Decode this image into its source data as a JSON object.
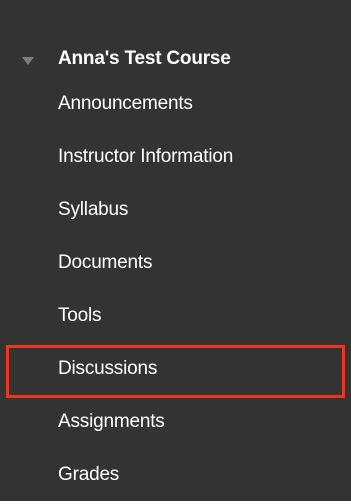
{
  "course": {
    "title": "Anna's Test Course",
    "expanded": true,
    "disclosure_icon": "triangle-down-icon"
  },
  "menu": {
    "items": [
      {
        "label": "Announcements",
        "highlighted": false
      },
      {
        "label": "Instructor Information",
        "highlighted": false
      },
      {
        "label": "Syllabus",
        "highlighted": false
      },
      {
        "label": "Documents",
        "highlighted": false
      },
      {
        "label": "Tools",
        "highlighted": false
      },
      {
        "label": "Discussions",
        "highlighted": true
      },
      {
        "label": "Assignments",
        "highlighted": false
      },
      {
        "label": "Grades",
        "highlighted": false
      }
    ]
  },
  "colors": {
    "menu_background": "#333333",
    "text": "#ffffff",
    "highlight_border": "#e8381d",
    "disclosure_icon": "#7d7d7d"
  }
}
